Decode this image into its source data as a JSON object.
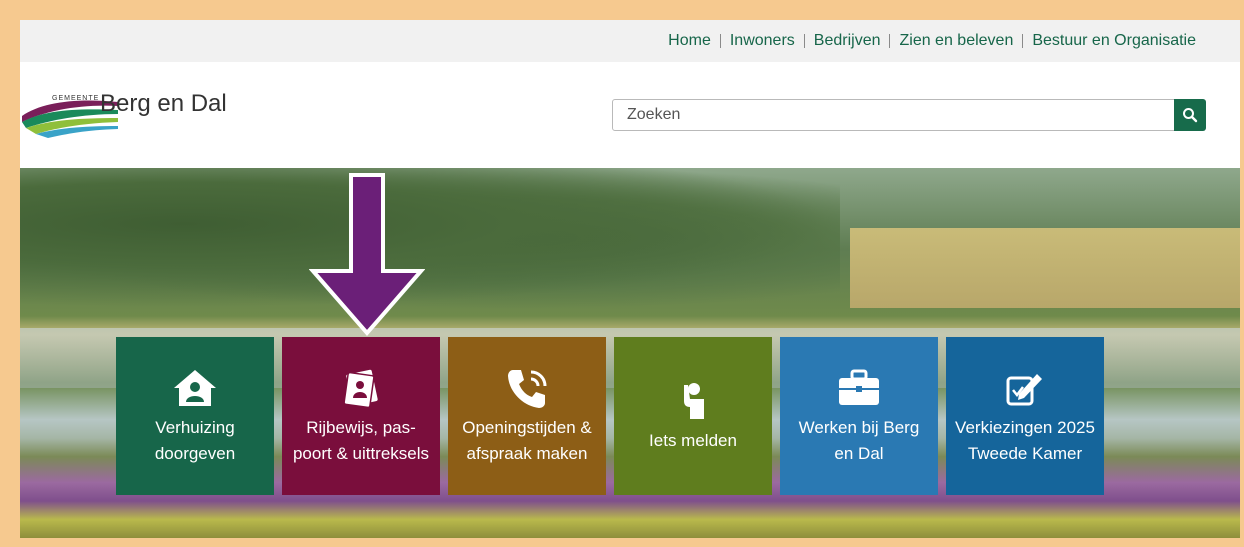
{
  "topnav": {
    "items": [
      {
        "label": "Home"
      },
      {
        "label": "Inwoners"
      },
      {
        "label": "Bedrijven"
      },
      {
        "label": "Zien en beleven"
      },
      {
        "label": "Bestuur en Organisatie"
      }
    ]
  },
  "logo": {
    "small_text": "GEMEENTE",
    "name": "Berg en Dal"
  },
  "search": {
    "placeholder": "Zoeken",
    "icon": "search-icon"
  },
  "tiles": [
    {
      "label": "Verhuizing doorgeven",
      "color": "#17664a",
      "icon": "house-person-icon"
    },
    {
      "label": "Rijbewijs, pas-poort & uittreksels",
      "color": "#7a0e3c",
      "icon": "id-document-icon"
    },
    {
      "label": "Openingstijden & afspraak maken",
      "color": "#8d5e16",
      "icon": "phone-call-icon"
    },
    {
      "label": "Iets melden",
      "color": "#5f7d1e",
      "icon": "hand-report-icon"
    },
    {
      "label": "Werken bij Berg en Dal",
      "color": "#2a79b3",
      "icon": "briefcase-icon"
    },
    {
      "label": "Verkiezingen 2025 Tweede Kamer",
      "color": "#15659b",
      "icon": "ballot-pen-icon"
    }
  ],
  "annotation": {
    "arrow_color": "#6b1f78"
  }
}
